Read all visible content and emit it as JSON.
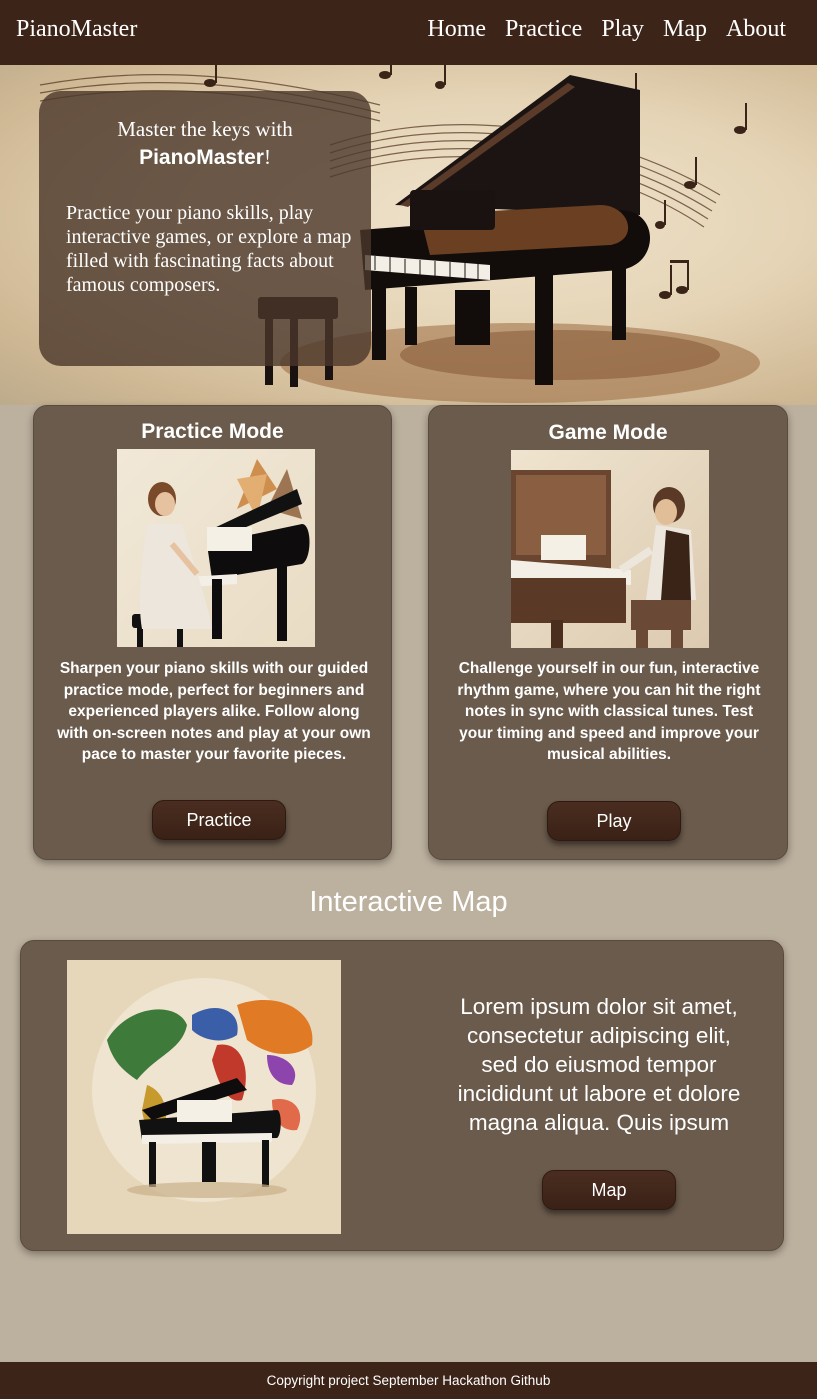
{
  "nav": {
    "brand": "PianoMaster",
    "links": [
      "Home",
      "Practice",
      "Play",
      "Map",
      "About"
    ]
  },
  "hero": {
    "title_prefix": "Master the keys with",
    "title_brand": "PianoMaster",
    "title_suffix": "!",
    "text": "Practice your piano skills, play interactive games, or explore a map filled with fascinating facts about famous composers."
  },
  "practice_card": {
    "title": "Practice Mode",
    "description": "Sharpen your piano skills with our guided practice mode, perfect for beginners and experienced players alike. Follow along with on-screen notes and play at your own pace to master your favorite pieces.",
    "button": "Practice"
  },
  "game_card": {
    "title": "Game Mode",
    "description": "Challenge yourself in our fun, interactive rhythm game, where you can hit the right notes in sync with classical tunes. Test your timing and speed and improve your musical abilities.",
    "button": "Play"
  },
  "map_section": {
    "heading": "Interactive Map",
    "text": "Lorem ipsum dolor sit amet, consectetur adipiscing elit, sed do eiusmod tempor incididunt ut labore et dolore magna aliqua. Quis ipsum",
    "button": "Map"
  },
  "footer": {
    "text": "Copyright project September Hackathon Github"
  },
  "colors": {
    "nav_bg": "#3d2418",
    "page_bg": "#bcb09e",
    "card_bg": "#6b5b4c",
    "button_bg": "#3a2116"
  }
}
